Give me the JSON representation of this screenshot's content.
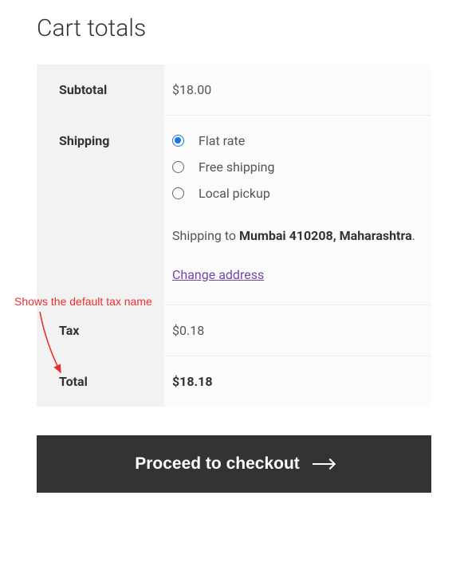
{
  "page_title": "Cart totals",
  "rows": {
    "subtotal": {
      "label": "Subtotal",
      "value": "$18.00"
    },
    "shipping": {
      "label": "Shipping",
      "options": [
        {
          "label": "Flat rate",
          "selected": true
        },
        {
          "label": "Free shipping",
          "selected": false
        },
        {
          "label": "Local pickup",
          "selected": false
        }
      ],
      "dest_prefix": "Shipping to ",
      "dest_bold": "Mumbai 410208, Maharashtra",
      "dest_suffix": ".",
      "change_link": "Change address"
    },
    "tax": {
      "label": "Tax",
      "value": "$0.18"
    },
    "total": {
      "label": "Total",
      "value": "$18.18"
    }
  },
  "checkout_label": "Proceed to checkout",
  "annotation": "Shows the default tax name"
}
